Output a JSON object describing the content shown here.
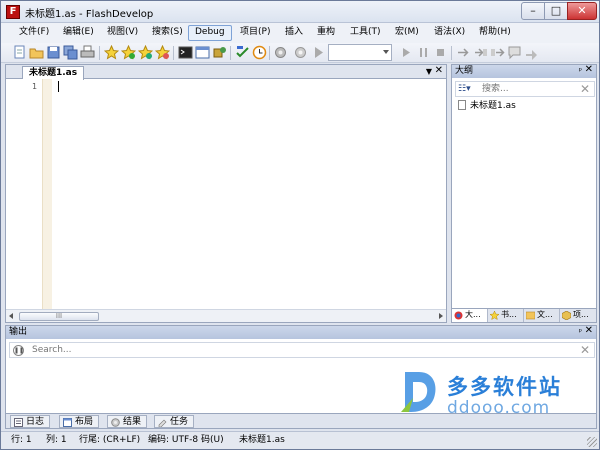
{
  "window": {
    "title": "未标题1.as - FlashDevelop",
    "minimize": "–",
    "maximize": "□",
    "close": "✕"
  },
  "menu": [
    "文件(F)",
    "编辑(E)",
    "视图(V)",
    "搜索(S)",
    "Debug",
    "项目(P)",
    "插入",
    "重构",
    "工具(T)",
    "宏(M)",
    "语法(X)",
    "帮助(H)"
  ],
  "toolbar": {
    "icons": [
      "new-file-icon",
      "open-folder-icon",
      "save-icon",
      "save-all-icon",
      "print-icon",
      "star-icon",
      "star-add-icon",
      "star-next-icon",
      "star-prev-icon",
      "terminal-icon",
      "layout-icon",
      "plugin-icon",
      "build-icon",
      "clock-icon",
      "gear-icon",
      "play-icon"
    ],
    "config_value": ""
  },
  "editor": {
    "tab_label": "未标题1.as",
    "dropdown_glyph": "▼",
    "close_glyph": "✕",
    "line_number": "1",
    "scroll_thumb": "III"
  },
  "outline": {
    "title": "大纲",
    "pin_glyph": "ᵖ",
    "close_glyph": "✕",
    "options_glyph": "☷▾",
    "search_placeholder": "搜索...",
    "clear_glyph": "✕",
    "file": "未标题1.as",
    "tabs": [
      "大...",
      "书...",
      "文...",
      "项..."
    ]
  },
  "output": {
    "title": "输出",
    "pin_glyph": "ᵖ",
    "close_glyph": "✕",
    "pause_glyph": "❚❚",
    "search_placeholder": "Search...",
    "clear_glyph": "✕",
    "tabs": [
      "日志",
      "布局",
      "结果",
      "任务"
    ]
  },
  "status": {
    "line": "行: 1",
    "col": "列: 1",
    "eol": "行尾: (CR+LF)",
    "encoding": "编码: UTF-8 码(U)",
    "file": "未标题1.as"
  },
  "watermark": {
    "cn": "多多软件站",
    "en": "ddooo.com"
  }
}
